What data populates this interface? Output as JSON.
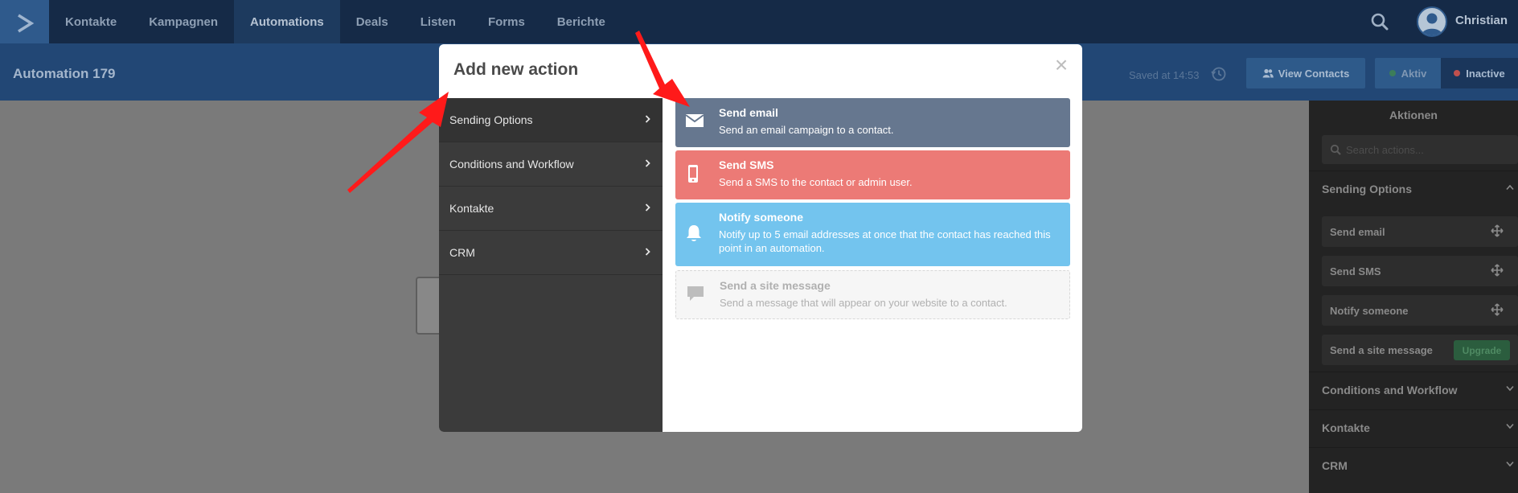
{
  "nav": {
    "items": [
      "Kontakte",
      "Kampagnen",
      "Automations",
      "Deals",
      "Listen",
      "Forms",
      "Berichte"
    ],
    "active_index": 2,
    "user_name": "Christian"
  },
  "subheader": {
    "title": "Automation 179",
    "saved": "Saved at 14:53",
    "view_contacts": "View Contacts",
    "aktiv": "Aktiv",
    "inactive": "Inactive"
  },
  "right_panel": {
    "header": "Aktionen",
    "search_placeholder": "Search actions...",
    "sections": [
      "Sending Options",
      "Conditions and Workflow",
      "Kontakte",
      "CRM"
    ],
    "items": [
      "Send email",
      "Send SMS",
      "Notify someone",
      "Send a site message"
    ],
    "upgrade": "Upgrade"
  },
  "modal": {
    "title": "Add new action",
    "close": "×",
    "nav": [
      "Sending Options",
      "Conditions and Workflow",
      "Kontakte",
      "CRM"
    ],
    "actions": [
      {
        "title": "Send email",
        "desc": "Send an email campaign to a contact.",
        "icon": "envelope-icon"
      },
      {
        "title": "Send SMS",
        "desc": "Send a SMS to the contact or admin user.",
        "icon": "phone-icon"
      },
      {
        "title": "Notify someone",
        "desc": "Notify up to 5 email addresses at once that the contact has reached this point in an automation.",
        "icon": "bell-icon"
      },
      {
        "title": "Send a site message",
        "desc": "Send a message that will appear on your website to a contact.",
        "icon": "chat-icon"
      }
    ]
  },
  "colors": {
    "nav_bg": "#152a47",
    "subheader_bg": "#224775",
    "email": "#66778f",
    "sms": "#ec7a76",
    "notify": "#73c4ee",
    "arrow": "#ff1a1a"
  }
}
